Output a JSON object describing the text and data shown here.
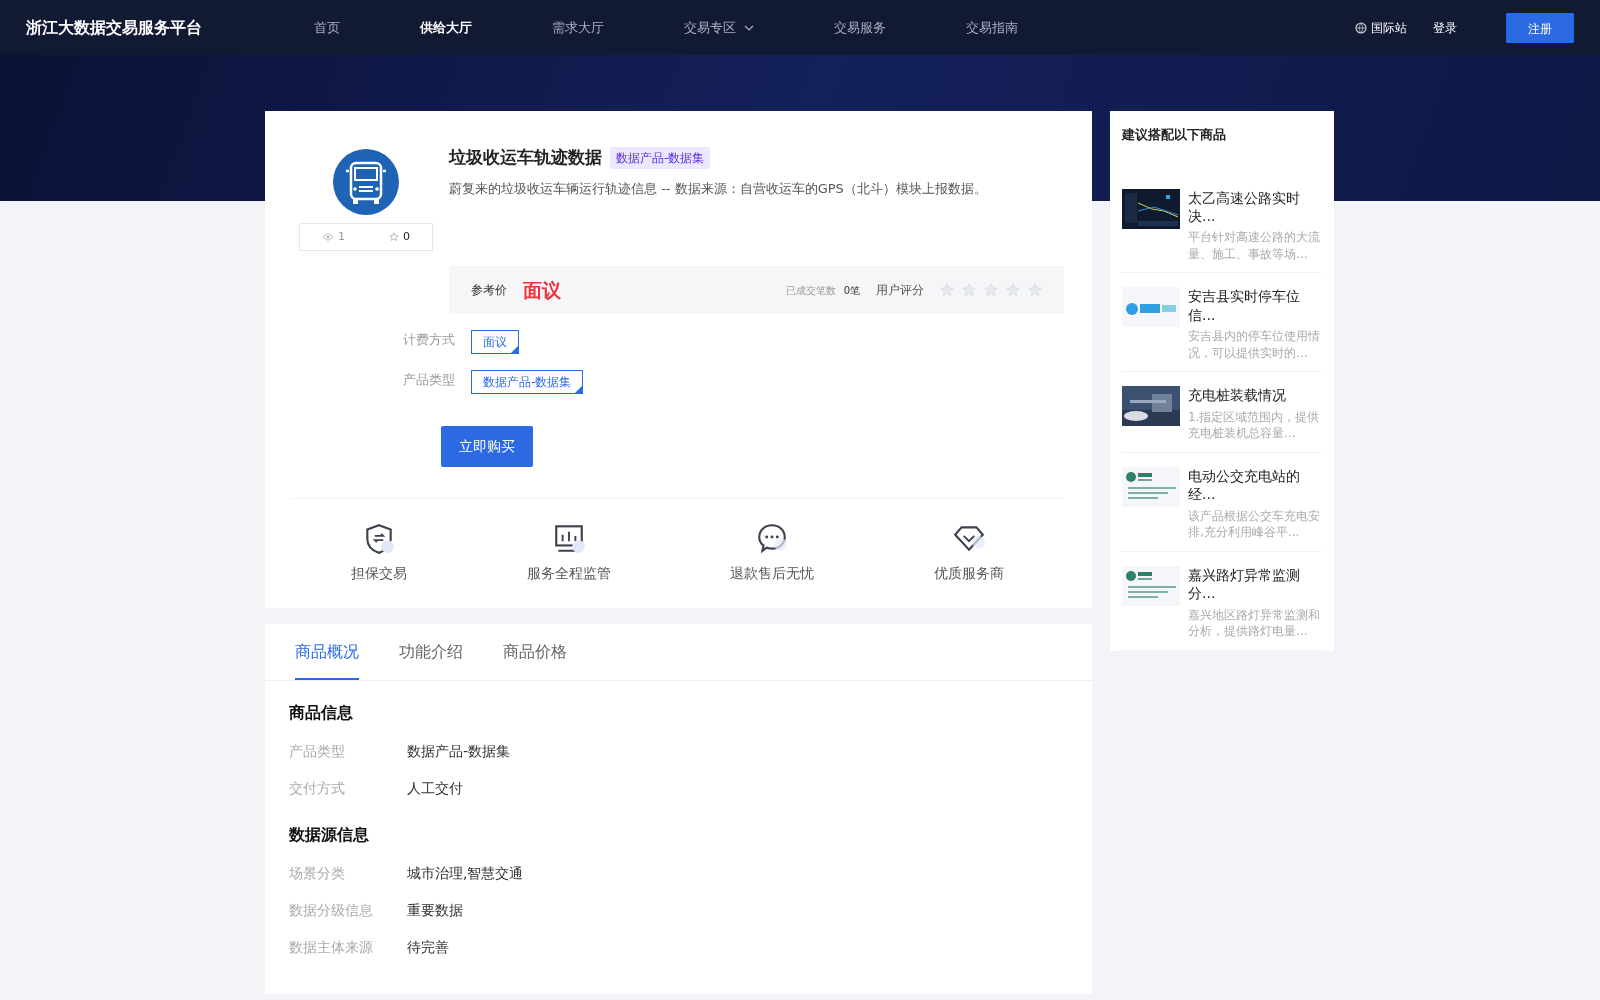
{
  "header": {
    "logo": "浙江大数据交易服务平台",
    "nav": [
      {
        "label": "首页",
        "selected": false,
        "dropdown": false
      },
      {
        "label": "供给大厅",
        "selected": true,
        "dropdown": false
      },
      {
        "label": "需求大厅",
        "selected": false,
        "dropdown": false
      },
      {
        "label": "交易专区",
        "selected": false,
        "dropdown": true
      },
      {
        "label": "交易服务",
        "selected": false,
        "dropdown": false
      },
      {
        "label": "交易指南",
        "selected": false,
        "dropdown": false
      }
    ],
    "language": "国际站",
    "login": "登录",
    "register": "注册"
  },
  "product": {
    "title": "垃圾收运车轨迹数据",
    "tag": "数据产品-数据集",
    "description": "蔚复来的垃圾收运车辆运行轨迹信息 -- 数据来源：自营收运车的GPS（北斗）模块上报数据。",
    "views": "1",
    "favorites": "0",
    "price_label": "参考价",
    "price": "面议",
    "deals_label": "已成交笔数",
    "deals": "0笔",
    "rating_label": "用户评分",
    "stars": 0,
    "options": [
      {
        "label": "计费方式",
        "choices": [
          {
            "text": "面议",
            "selected": true
          }
        ]
      },
      {
        "label": "产品类型",
        "choices": [
          {
            "text": "数据产品-数据集",
            "selected": true
          }
        ]
      }
    ],
    "buy": "立即购买"
  },
  "guarantees": [
    {
      "kind": "shield",
      "label": "担保交易"
    },
    {
      "kind": "monitor",
      "label": "服务全程监管"
    },
    {
      "kind": "chat",
      "label": "退款售后无忧"
    },
    {
      "kind": "diamond",
      "label": "优质服务商"
    }
  ],
  "recommend": {
    "title": "建议搭配以下商品",
    "items": [
      {
        "title": "太乙高速公路实时决...",
        "description": "平台针对高速公路的大流量、施工、事故等场..."
      },
      {
        "title": "安吉县实时停车位信...",
        "description": "安吉县内的停车位使用情况，可以提供实时的..."
      },
      {
        "title": "充电桩装载情况",
        "description": "1.指定区域范围内，提供充电桩装机总容量..."
      },
      {
        "title": "电动公交充电站的经...",
        "description": "该产品根据公交车充电安排,充分利用峰谷平..."
      },
      {
        "title": "嘉兴路灯异常监测分...",
        "description": "嘉兴地区路灯异常监测和分析，提供路灯电量..."
      }
    ]
  },
  "tabs": [
    {
      "label": "商品概况",
      "selected": true
    },
    {
      "label": "功能介绍",
      "selected": false
    },
    {
      "label": "商品价格",
      "selected": false
    }
  ],
  "sections": [
    {
      "title": "商品信息",
      "rows": [
        {
          "label": "产品类型",
          "value": "数据产品-数据集"
        },
        {
          "label": "交付方式",
          "value": "人工交付"
        }
      ]
    },
    {
      "title": "数据源信息",
      "rows": [
        {
          "label": "场景分类",
          "value": "城市治理,智慧交通"
        },
        {
          "label": "数据分级信息",
          "value": "重要数据"
        },
        {
          "label": "数据主体来源",
          "value": "待完善"
        }
      ]
    }
  ]
}
